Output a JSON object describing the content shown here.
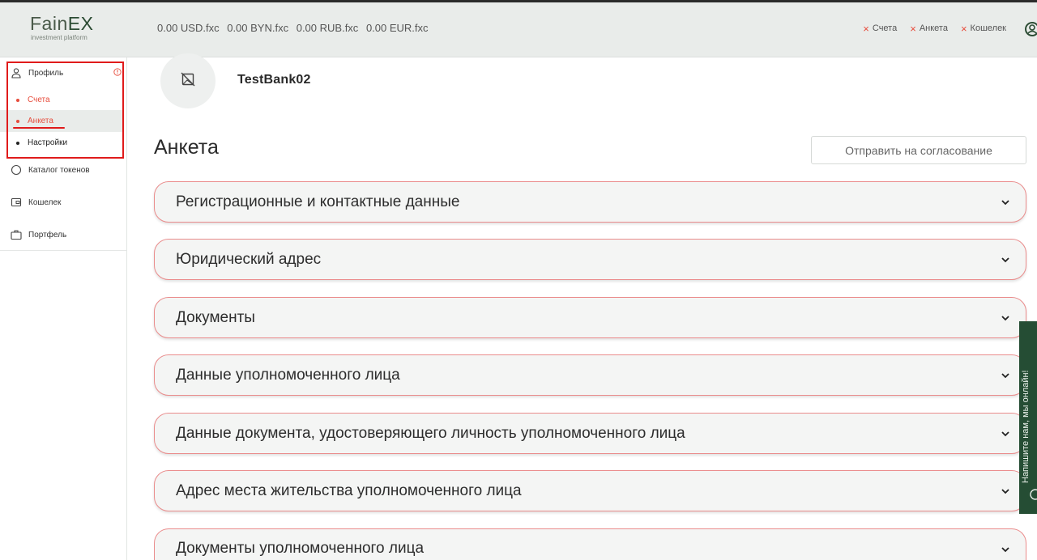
{
  "header": {
    "logo": {
      "main_a": "Fain",
      "main_b": "EX",
      "sub": "investment platform"
    },
    "balances": [
      "0.00 USD.fxc",
      "0.00 BYN.fxc",
      "0.00 RUB.fxc",
      "0.00 EUR.fxc"
    ],
    "status_items": [
      "Счета",
      "Анкета",
      "Кошелек"
    ],
    "colors": {
      "status_x": "#e74c3c",
      "header_bg": "#e9ecea"
    }
  },
  "sidebar": {
    "profile": "Профиль",
    "sub_items": [
      {
        "label": "Счета",
        "color": "#e74c3c"
      },
      {
        "label": "Анкета",
        "color": "#e74c3c"
      },
      {
        "label": "Настройки",
        "color": "#222222"
      }
    ],
    "items": [
      "Каталог токенов",
      "Кошелек",
      "Портфель"
    ],
    "colors": {
      "highlight": "#e01b1b"
    }
  },
  "main": {
    "company": "TestBank02",
    "title": "Анкета",
    "submit_label": "Отправить на согласование",
    "sections": [
      "Регистрационные и контактные данные",
      "Юридический адрес",
      "Документы",
      "Данные уполномоченного лица",
      "Данные документа, удостоверяющего личность уполномоченного лица",
      "Адрес места жительства уполномоченного лица",
      "Документы уполномоченного лица"
    ],
    "colors": {
      "accordion_border": "#ea8c8c",
      "accordion_bg": "#f4f5f4"
    }
  },
  "chat": {
    "label": "Напишите нам, мы онлайн!",
    "color": "#254d34"
  }
}
